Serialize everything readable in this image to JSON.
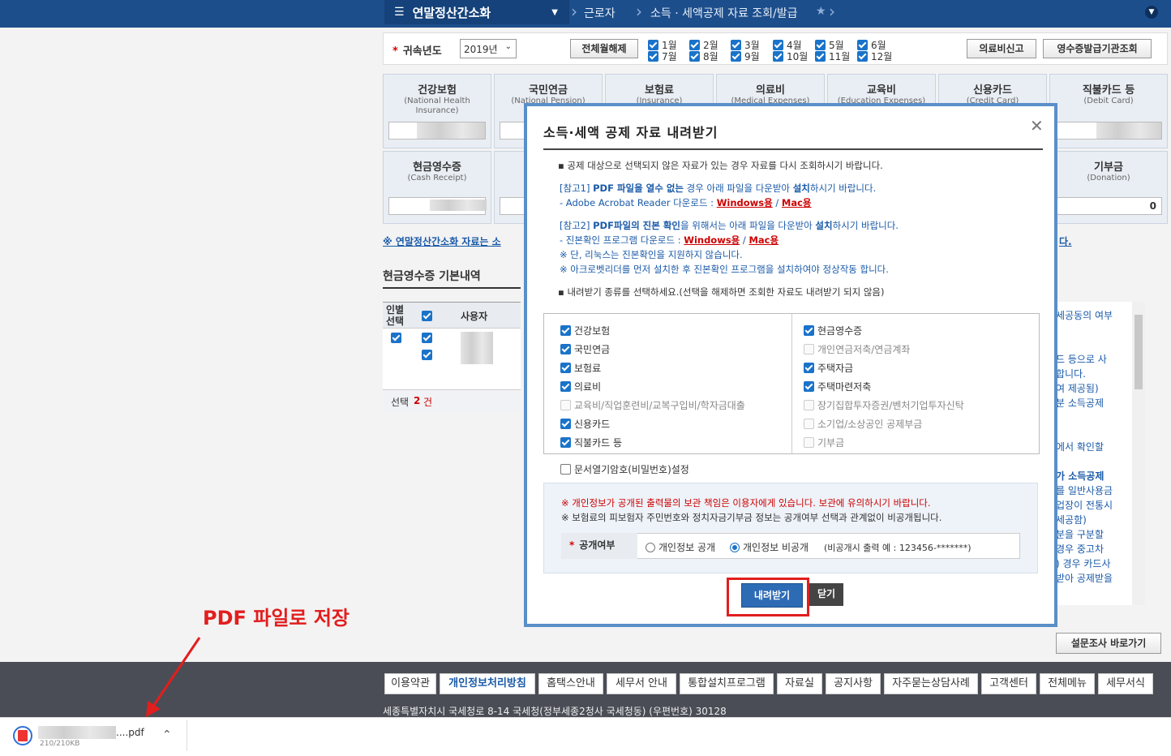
{
  "topnav": {
    "menu_title": "연말정산간소화",
    "crumb1": "근로자",
    "crumb2": "소득 · 세액공제 자료 조회/발급"
  },
  "filter": {
    "year_label": "귀속년도",
    "year_value": "2019년",
    "toggle_all": "전체월해제",
    "months": [
      "1월",
      "2월",
      "3월",
      "4월",
      "5월",
      "6월",
      "7월",
      "8월",
      "9월",
      "10월",
      "11월",
      "12월"
    ],
    "medical_report": "의료비신고",
    "receipt_agency": "영수증발급기관조회"
  },
  "categories": [
    {
      "title": "건강보험",
      "sub": "(National Health Insurance)"
    },
    {
      "title": "국민연금",
      "sub": "(National Pension)"
    },
    {
      "title": "보험료",
      "sub": "(Insurance)"
    },
    {
      "title": "의료비",
      "sub": "(Medical Expenses)"
    },
    {
      "title": "교육비",
      "sub": "(Education Expenses)"
    },
    {
      "title": "신용카드",
      "sub": "(Credit Card)"
    },
    {
      "title": "직불카드 등",
      "sub": "(Debit Card)"
    },
    {
      "title": "현금영수증",
      "sub": "(Cash Receipt)"
    },
    {
      "title": "기부금",
      "sub": "(Donation)"
    }
  ],
  "donation_value": "0",
  "notice_link_left": "※ 연말정산간소화 자료는 소",
  "notice_link_right": "다.",
  "section": {
    "title": "현금영수증 기본내역",
    "col_select": "인별\n선택",
    "col_user": "사용자",
    "footer_prefix": "선택",
    "footer_count": "2",
    "footer_suffix": "건"
  },
  "right_texts": [
    "세공동의 여부",
    "드 등으로 사",
    "합니다.",
    "여 제공됨)",
    "분 소득공제",
    "에서 확인할",
    "가 소득공제",
    "를 일반사용금",
    "업장이 전통시",
    "세공함)",
    "분을 구분할",
    "경우 중고차",
    ") 경우 카드사",
    "받아 공제받을"
  ],
  "survey_button": "설문조사 바로가기",
  "modal": {
    "title": "소득·세액 공제 자료 내려받기",
    "line1": "공제 대상으로 선택되지 않은 자료가 있는 경우 자료를 다시 조회하시기 바랍니다.",
    "ref1_a": "[참고1] ",
    "ref1_b": "PDF 파일을 열수 없는",
    "ref1_c": " 경우  아래 파일을 다운받아 ",
    "ref1_d": "설치",
    "ref1_e": "하시기 바랍니다.",
    "ref1_dl": "- Adobe Acrobat Reader 다운로드 : ",
    "win": "Windows용",
    "slash": " / ",
    "mac": "Mac용",
    "ref2_a": "[참고2] ",
    "ref2_b": "PDF파일의 진본 확인",
    "ref2_c": "을 위해서는 아래 파일을 다운받아 ",
    "ref2_d": "설치",
    "ref2_e": "하시기 바랍니다.",
    "ref2_dl": "- 진본확인 프로그램 다운로드 : ",
    "note1": "※ 단, 리눅스는 진본확인을 지원하지 않습니다.",
    "note2": "※ 아크로벳리더를 먼저 설치한 후 진본확인 프로그램을 설치하여야 정상작동 합니다.",
    "select_hint": "내려받기 종류를 선택하세요.(선택을 해제하면 조회한 자료도 내려받기 되지 않음)",
    "left_items": [
      {
        "label": "건강보험",
        "checked": true
      },
      {
        "label": "국민연금",
        "checked": true
      },
      {
        "label": "보험료",
        "checked": true
      },
      {
        "label": "의료비",
        "checked": true
      },
      {
        "label": "교육비/직업훈련비/교복구입비/학자금대출",
        "checked": false
      },
      {
        "label": "신용카드",
        "checked": true
      },
      {
        "label": "직불카드 등",
        "checked": true
      }
    ],
    "right_items": [
      {
        "label": "현금영수증",
        "checked": true
      },
      {
        "label": "개인연금저축/연금계좌",
        "checked": false
      },
      {
        "label": "주택자금",
        "checked": true
      },
      {
        "label": "주택마련저축",
        "checked": true
      },
      {
        "label": "장기집합투자증권/벤처기업투자신탁",
        "checked": false
      },
      {
        "label": "소기업/소상공인 공제부금",
        "checked": false
      },
      {
        "label": "기부금",
        "checked": false
      }
    ],
    "password_label": "문서열기암호(비밀번호)설정",
    "privacy_warn": "※ 개인정보가 공개된 출력물의 보관 책임은 이용자에게 있습니다. 보관에 유의하시기 바랍니다.",
    "privacy_note": "※ 보험료의 피보험자 주민번호와 정치자금기부금 정보는 공개여부 선택과 관계없이 비공개됩니다.",
    "public_label": "공개여부",
    "opt_public": "개인정보 공개",
    "opt_private": "개인정보 비공개",
    "private_example": "(비공개시 출력 예 : 123456-*******)",
    "download_btn": "내려받기",
    "close_btn": "닫기"
  },
  "annotation": "PDF 파일로 저장",
  "footer": {
    "links": [
      "이용약관",
      "개인정보처리방침",
      "홈택스안내",
      "세무서 안내",
      "통합설치프로그램",
      "자료실",
      "공지사항",
      "자주묻는상담사례",
      "고객센터",
      "전체메뉴",
      "세무서식"
    ],
    "address": "세종특별자치시 국세청로 8-14 국세청(정부세종2청사 국세청동) (우편번호) 30128"
  },
  "download_bar": {
    "filename_suffix": "....pdf",
    "size": "210/210KB"
  }
}
